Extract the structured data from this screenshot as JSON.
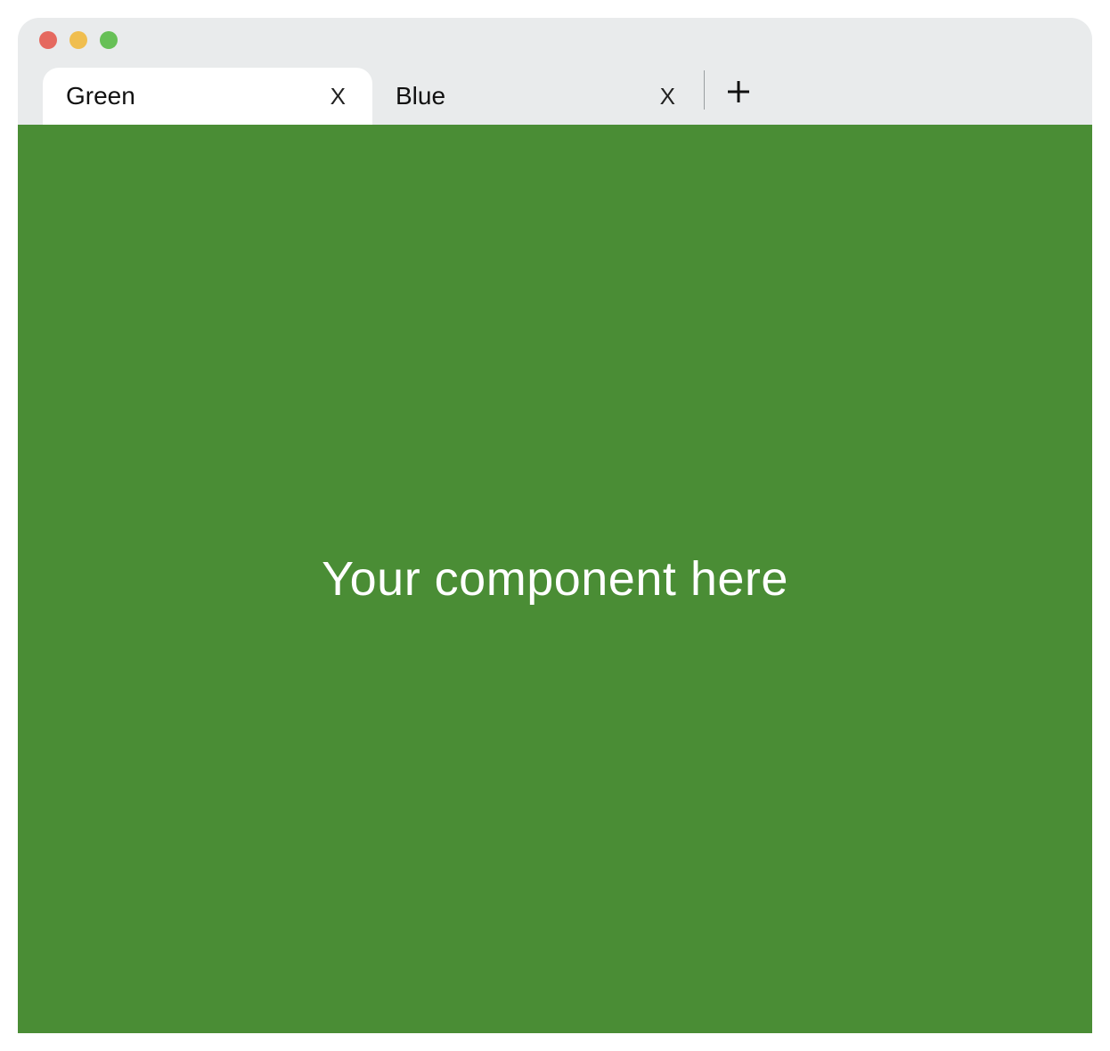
{
  "window": {
    "traffic_lights": {
      "close_color": "#e5695f",
      "minimize_color": "#f0be4f",
      "zoom_color": "#67c057"
    }
  },
  "tabs": [
    {
      "title": "Green",
      "close_label": "X",
      "active": true
    },
    {
      "title": "Blue",
      "close_label": "X",
      "active": false
    }
  ],
  "new_tab": {
    "label": "+"
  },
  "content": {
    "background_color": "#4a8d35",
    "placeholder_text": "Your component here"
  }
}
